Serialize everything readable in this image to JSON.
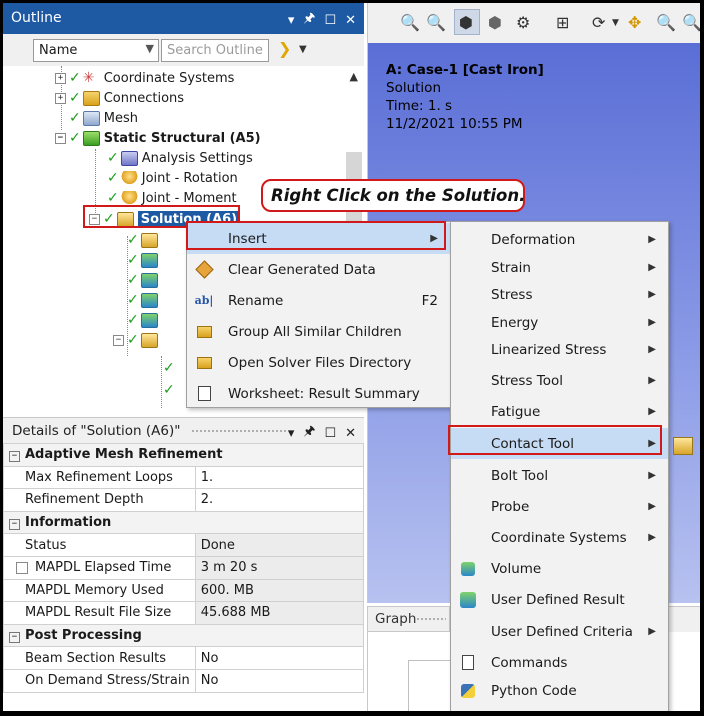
{
  "outline": {
    "title": "Outline",
    "name_filter": "Name",
    "search_placeholder": "Search Outline",
    "tree": {
      "coordinate_systems": "Coordinate Systems",
      "connections": "Connections",
      "mesh": "Mesh",
      "static_structural": "Static Structural (A5)",
      "analysis_settings": "Analysis Settings",
      "joint_rotation": "Joint - Rotation",
      "joint_moment": "Joint - Moment",
      "solution": "Solution (A6)"
    }
  },
  "details": {
    "title": "Details of \"Solution (A6)\"",
    "sections": {
      "adaptive": "Adaptive Mesh Refinement",
      "information": "Information",
      "post": "Post Processing"
    },
    "rows": {
      "max_refinement_loops": {
        "label": "Max Refinement Loops",
        "value": "1."
      },
      "refinement_depth": {
        "label": "Refinement Depth",
        "value": "2."
      },
      "status": {
        "label": "Status",
        "value": "Done"
      },
      "elapsed_time": {
        "label": "MAPDL Elapsed Time",
        "value": "3 m 20 s"
      },
      "memory_used": {
        "label": "MAPDL Memory Used",
        "value": "600. MB"
      },
      "result_file_size": {
        "label": "MAPDL Result File Size",
        "value": "45.688 MB"
      },
      "beam_section_results": {
        "label": "Beam Section Results",
        "value": "No"
      },
      "on_demand": {
        "label": "On Demand Stress/Strain",
        "value": "No"
      }
    }
  },
  "viewport": {
    "case": "A: Case-1 [Cast Iron]",
    "object": "Solution",
    "time": "Time: 1. s",
    "date": "11/2/2021 10:55 PM"
  },
  "graph": {
    "title": "Graph"
  },
  "callout": "Right Click on the Solution.",
  "context_menu": {
    "insert": "Insert",
    "clear_generated_data": "Clear Generated Data",
    "rename": "Rename",
    "rename_shortcut": "F2",
    "group_children": "Group All Similar Children",
    "open_solver_dir": "Open Solver Files Directory",
    "worksheet": "Worksheet: Result Summary"
  },
  "insert_menu": {
    "deformation": "Deformation",
    "strain": "Strain",
    "stress": "Stress",
    "energy": "Energy",
    "linearized_stress": "Linearized Stress",
    "stress_tool": "Stress Tool",
    "fatigue": "Fatigue",
    "contact_tool": "Contact Tool",
    "bolt_tool": "Bolt Tool",
    "probe": "Probe",
    "coordinate_systems": "Coordinate Systems",
    "volume": "Volume",
    "user_defined_result": "User Defined Result",
    "user_defined_criteria": "User Defined Criteria",
    "commands": "Commands",
    "python_code": "Python Code"
  },
  "colors": {
    "accent": "#1e5aa3",
    "highlight_box": "#d21919",
    "menu_hover": "#c6dcf5"
  }
}
